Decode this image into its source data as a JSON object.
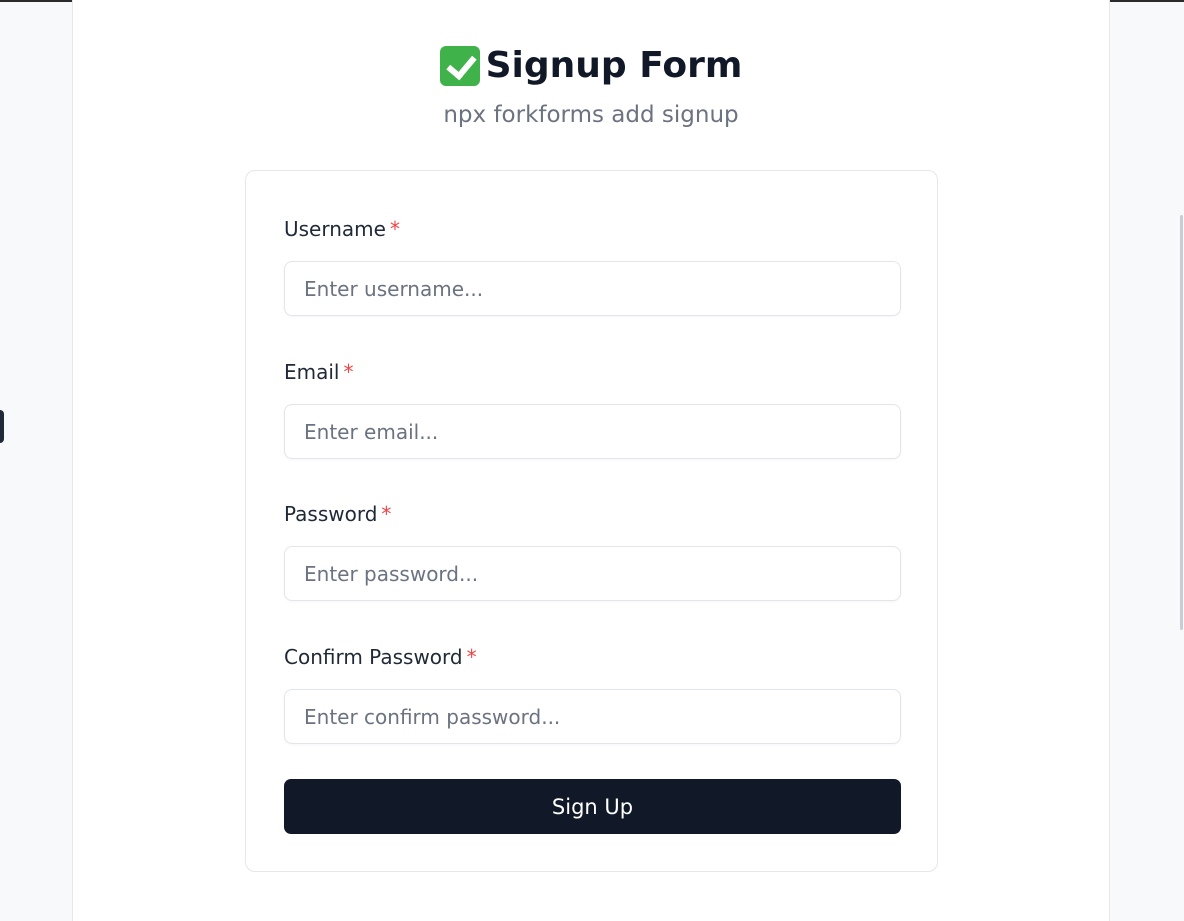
{
  "header": {
    "title": "Signup Form",
    "subtitle": "npx forkforms add signup"
  },
  "form": {
    "required_marker": "*",
    "fields": [
      {
        "label": "Username",
        "placeholder": "Enter username...",
        "value": ""
      },
      {
        "label": "Email",
        "placeholder": "Enter email...",
        "value": ""
      },
      {
        "label": "Password",
        "placeholder": "Enter password...",
        "value": ""
      },
      {
        "label": "Confirm Password",
        "placeholder": "Enter confirm password...",
        "value": ""
      }
    ],
    "submit_label": "Sign Up"
  },
  "icons": {
    "title_icon": "check-mark-button-icon"
  },
  "colors": {
    "accent": "#111827",
    "required": "#ef4444",
    "check": "#3fb24a",
    "muted_text": "#6b7280"
  }
}
